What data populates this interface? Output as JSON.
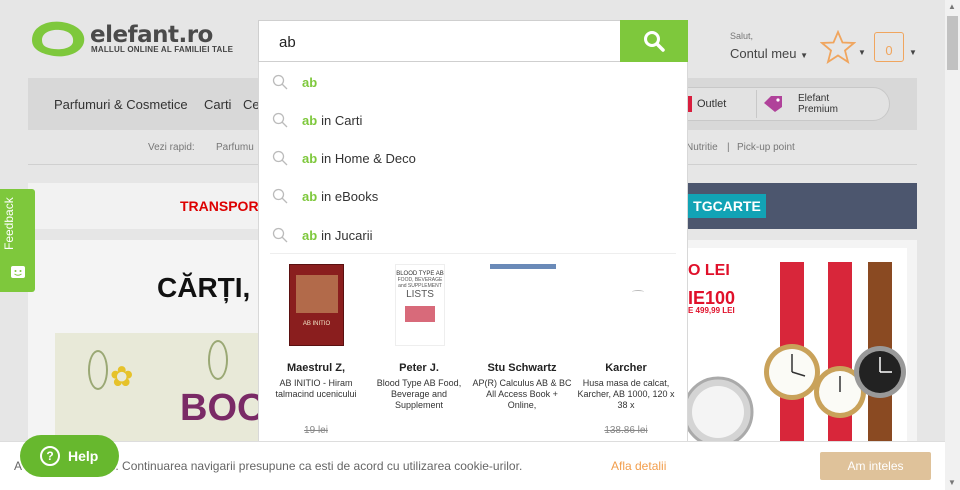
{
  "header": {
    "logo_text": "elefant.ro",
    "logo_tagline": "MALLUL ONLINE AL FAMILIEI TALE",
    "search_value": "ab",
    "account_greeting": "Salut,",
    "account_label": "Contul meu",
    "cart_count": "0"
  },
  "nav": {
    "items": [
      "Parfumuri & Cosmetice",
      "Carti",
      "Ce"
    ],
    "outlet": "Outlet",
    "premium_line1": "Elefant",
    "premium_line2": "Premium"
  },
  "quick_links": {
    "label": "Vezi rapid:",
    "items": [
      "Parfumu",
      "Nutritie",
      "|",
      "Pick-up point"
    ]
  },
  "banner": {
    "left_text": "TRANSPOR",
    "code": "TGCARTE"
  },
  "promo": {
    "heading": "CĂRȚI,",
    "book_letters": "BOO",
    "voucher_line1": "O LEI",
    "voucher_line2": "IE100",
    "voucher_line3": "E 499,99 LEI"
  },
  "suggestions": [
    {
      "query": "ab",
      "scope": ""
    },
    {
      "query": "ab",
      "scope": "in Carti"
    },
    {
      "query": "ab",
      "scope": "in Home & Deco"
    },
    {
      "query": "ab",
      "scope": "in eBooks"
    },
    {
      "query": "ab",
      "scope": "in Jucarii"
    }
  ],
  "products": [
    {
      "title": "Maestrul Z,",
      "desc": "AB INITIO - Hiram talmacind ucenicului",
      "price": "19 lei"
    },
    {
      "title": "Peter J.",
      "desc": "Blood Type AB Food, Beverage and Supplement",
      "price": ""
    },
    {
      "title": "Stu Schwartz",
      "desc": "AP(R) Calculus AB & BC All Access Book + Online,",
      "price": ""
    },
    {
      "title": "Karcher",
      "desc": "Husa masa de calcat, Karcher, AB 1000, 120 x 38 x",
      "price": "138.86 lei"
    }
  ],
  "book_covers": {
    "book1_text": "AB INITIO",
    "book2_line1": "BLOOD TYPE AB",
    "book2_line2": "FOOD, BEVERAGE and SUPPLEMENT",
    "book2_line3": "LISTS"
  },
  "cookie": {
    "text": "A             e cookies. Continuarea navigarii presupune ca esti de acord cu utilizarea cookie-urilor.",
    "link": "Afla detalii",
    "accept": "Am inteles"
  },
  "help_label": "Help",
  "help_icon": "?",
  "feedback_label": "Feedback",
  "colors": {
    "brand_green": "#7ec83c",
    "cart_orange": "#f0a55e",
    "cookie_accept": "#dfc29a",
    "link_orange": "#f29e4c"
  }
}
